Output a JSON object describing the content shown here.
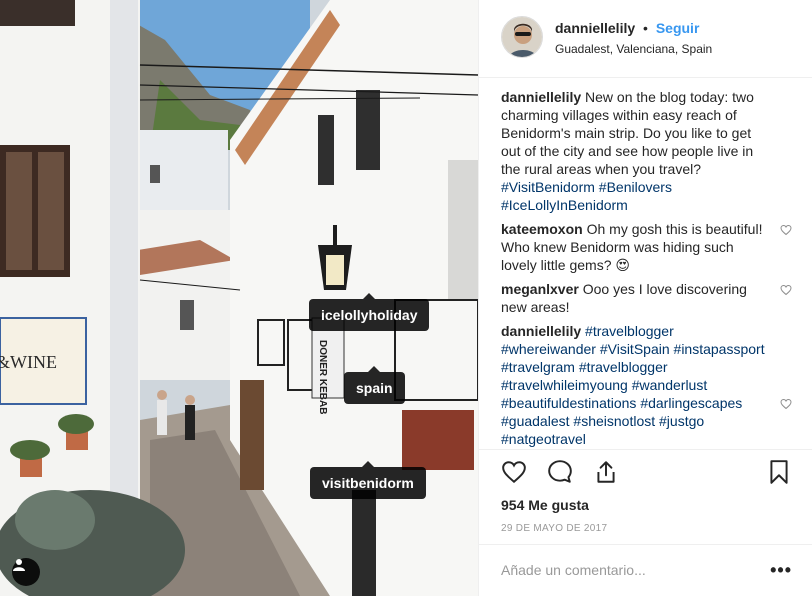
{
  "post": {
    "photo_tags": [
      "icelollyholiday",
      "spain",
      "visitbenidorm"
    ],
    "author": "danniellelily",
    "separator": "•",
    "follow_label": "Seguir",
    "location": "Guadalest, Valenciana, Spain",
    "caption": {
      "user": "danniellelily",
      "text": "New on the blog today: two charming villages within easy reach of Benidorm's main strip. Do you like to get out of the city and see how people live in the rural areas when you travel?",
      "hashtags": [
        "#VisitBenidorm",
        "#Benilovers",
        "#IceLollyInBenidorm"
      ]
    },
    "comments": [
      {
        "user": "kateemoxon",
        "text": "Oh my gosh this is beautiful! Who knew Benidorm was hiding such lovely little gems? 😍"
      },
      {
        "user": "meganlxver",
        "text": "Ooo yes I love discovering new areas!"
      },
      {
        "user": "danniellelily",
        "hashtags": [
          "#travelblogger",
          "#whereiwander",
          "#VisitSpain",
          "#instapassport",
          "#travelgram",
          "#travelblogger",
          "#travelwhileimyoung",
          "#wanderlust",
          "#beautifuldestinations",
          "#darlingescapes",
          "#guadalest",
          "#sheisnotlost",
          "#justgo",
          "#natgeotravel"
        ]
      }
    ],
    "likes": "954 Me gusta",
    "date": "29 DE MAYO DE 2017",
    "comment_placeholder": "Añade un comentario...",
    "more_label": "•••",
    "icons": [
      "heart-icon",
      "comment-icon",
      "share-icon",
      "bookmark-icon",
      "user-tag-icon"
    ],
    "colors": {
      "accent": "#3897f0",
      "hashtag": "#003569",
      "text": "#262626",
      "muted": "#999999"
    }
  }
}
